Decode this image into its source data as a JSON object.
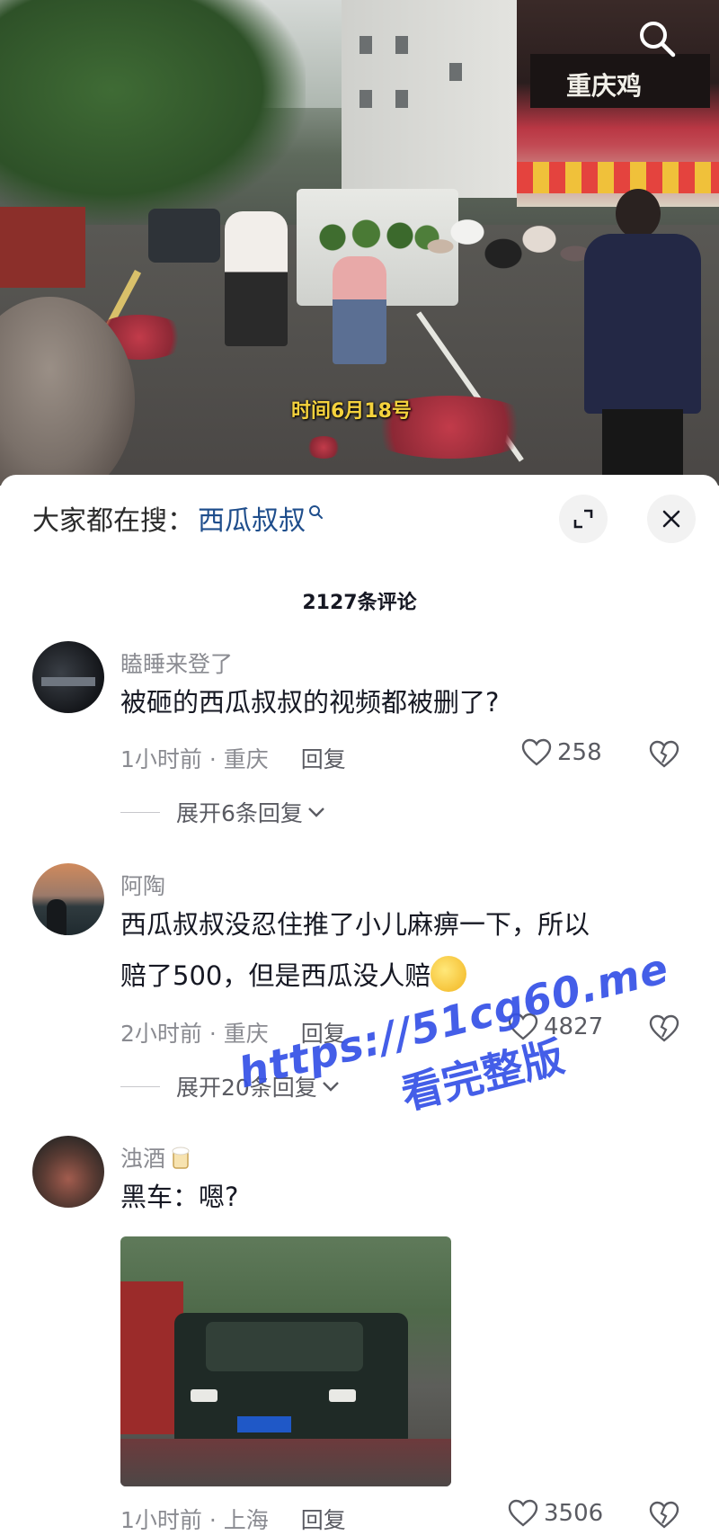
{
  "video": {
    "caption": "时间6月18号",
    "shop_sign_text": "重庆鸡"
  },
  "sheet": {
    "search_prefix": "大家都在搜：",
    "search_term": "西瓜叔叔",
    "comment_count": "2127条评论"
  },
  "comments": [
    {
      "user": "瞌睡来登了",
      "text": "被砸的西瓜叔叔的视频都被删了?",
      "time_location": "1小时前 · 重庆",
      "reply_label": "回复",
      "likes": "258",
      "expand_label": "展开6条回复"
    },
    {
      "user": "阿陶",
      "text_line1": "西瓜叔叔没忍住推了小儿麻痹一下，所以",
      "text_line2": "赔了500，但是西瓜没人赔",
      "time_location": "2小时前 · 重庆",
      "reply_label": "回复",
      "likes": "4827",
      "expand_label": "展开20条回复"
    },
    {
      "user": "浊酒",
      "text": "黑车：嗯?",
      "time_location": "1小时前 · 上海",
      "reply_label": "回复",
      "likes": "3506"
    }
  ],
  "watermark": {
    "line1": "https://51cg60.me",
    "line2": "看完整版"
  },
  "colors": {
    "search_term": "#1f4e8c",
    "meta_gray": "#8a8b91",
    "caption_yellow": "#f4d23d",
    "watermark_blue": "#3450e6"
  },
  "icons": [
    "search-icon",
    "expand-icon",
    "close-icon",
    "heart-icon",
    "broken-heart-icon",
    "chevron-down-icon",
    "beer-emoji-icon",
    "embarrassed-emoji-icon"
  ]
}
